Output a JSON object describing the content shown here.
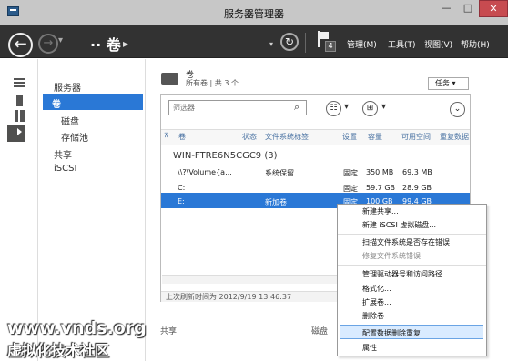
{
  "window": {
    "title": "服务器管理器",
    "minimize": "—",
    "maximize": "□",
    "close": "✕"
  },
  "nav": {
    "back": "←",
    "forward": "→",
    "dropdown": "▾",
    "breadcrumb_prefix": "··",
    "breadcrumb": "卷",
    "breadcrumb_arrow": "▸",
    "menu_dropdown": "▾",
    "refresh": "↻",
    "notifications": "4",
    "menus": [
      "管理(M)",
      "工具(T)",
      "视图(V)",
      "帮助(H)"
    ]
  },
  "sidebar": {
    "items": [
      "服务器",
      "卷",
      "磁盘",
      "存储池",
      "共享",
      "iSCSI"
    ]
  },
  "volume": {
    "title": "卷",
    "subtitle": "所有卷 | 共 3 个",
    "tasks": "任务",
    "filter_placeholder": "筛选器",
    "search_icon": "⌕",
    "list_icon": "☷",
    "filter_icon": "⊞",
    "expand_icon": "⌄"
  },
  "columns": [
    "卷",
    "状态",
    "文件系统标签",
    "设置",
    "容量",
    "可用空间",
    "重复数据"
  ],
  "group": "WIN-FTRE6N5CGC9 (3)",
  "rows": [
    {
      "volume": "\\\\?\\Volume{a...",
      "label": "系统保留",
      "setting": "固定",
      "capacity": "350 MB",
      "free": "69.3 MB"
    },
    {
      "volume": "C:",
      "label": "",
      "setting": "固定",
      "capacity": "59.7 GB",
      "free": "28.9 GB"
    },
    {
      "volume": "E:",
      "label": "新加卷",
      "setting": "固定",
      "capacity": "100 GB",
      "free": "99.4 GB"
    }
  ],
  "status": "上次刷新时间为 2012/9/19 13:46:37",
  "bottom_labels": [
    "共享",
    "磁盘"
  ],
  "context_menu": [
    "新建共享...",
    "新建 iSCSI 虚拟磁盘...",
    "扫描文件系统是否存在错误",
    "修复文件系统错误",
    "管理驱动器号和访问路径...",
    "格式化...",
    "扩展卷...",
    "删除卷",
    "配置数据删除重复",
    "属性"
  ],
  "watermark": "www.vnds.org",
  "community": "虚拟化技术社区"
}
